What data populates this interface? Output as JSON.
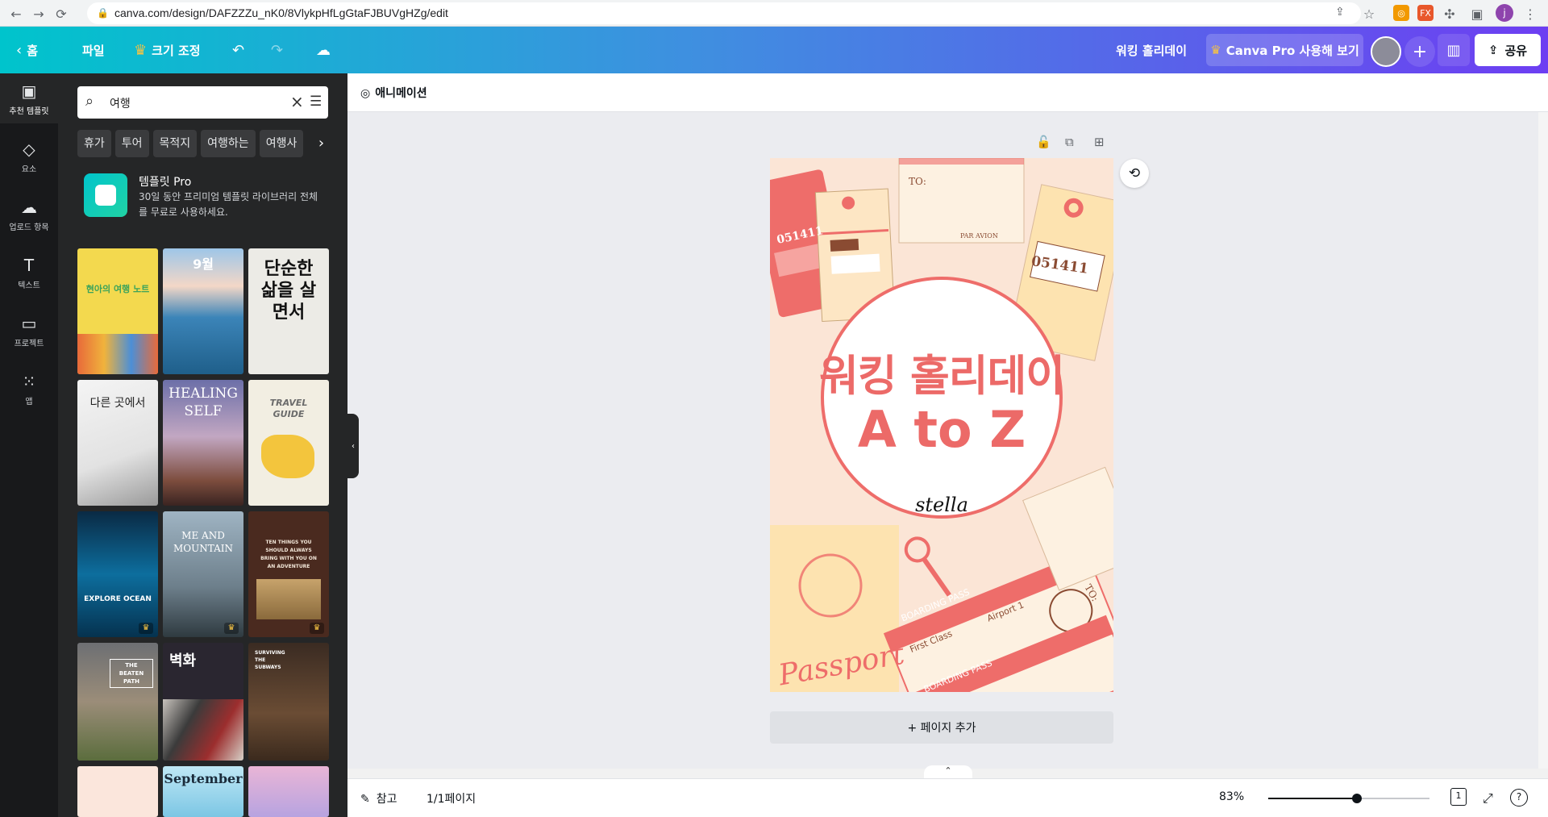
{
  "browser": {
    "url": "canva.com/design/DAFZZZu_nK0/8VlykpHfLgGtaFJBUVgHZg/edit",
    "profile_initial": "j"
  },
  "topbar": {
    "home": "홈",
    "file": "파일",
    "resize": "크기 조정",
    "doc_title": "워킹 홀리데이",
    "pro_button": "Canva Pro 사용해 보기",
    "share": "공유"
  },
  "rail": {
    "items": [
      {
        "label": "추천 템플릿",
        "icon": "template-icon"
      },
      {
        "label": "요소",
        "icon": "elements-icon"
      },
      {
        "label": "업로드 항목",
        "icon": "upload-icon"
      },
      {
        "label": "텍스트",
        "icon": "text-icon"
      },
      {
        "label": "프로젝트",
        "icon": "folder-icon"
      },
      {
        "label": "앱",
        "icon": "apps-icon"
      }
    ]
  },
  "panel": {
    "search_value": "여행",
    "chips": [
      "휴가",
      "투어",
      "목적지",
      "여행하는",
      "여행사"
    ],
    "promo_title": "템플릿 Pro",
    "promo_desc": "30일 동안 프리미엄 템플릿 라이브러리 전체를 무료로 사용하세요.",
    "thumbs": [
      {
        "text": "현아의 여행 노트"
      },
      {
        "text": "9월"
      },
      {
        "text": "단순한 삶을 살면서"
      },
      {
        "text": "다른 곳에서"
      },
      {
        "text": "HEALING SELF"
      },
      {
        "text": "TRAVEL GUIDE"
      },
      {
        "text": "EXPLORE OCEAN"
      },
      {
        "text": "ME AND MOUNTAIN"
      },
      {
        "text": "TEN THINGS YOU SHOULD ALWAYS BRING WITH YOU ON AN ADVENTURE"
      },
      {
        "text": "THE BEATEN PATH"
      },
      {
        "text": "벽화"
      },
      {
        "text": "SURVIVING THE SUBWAYS"
      },
      {
        "text": ""
      },
      {
        "text": "September"
      },
      {
        "text": ""
      }
    ]
  },
  "editor": {
    "animation": "애니메이션",
    "add_page": "+ 페이지 추가",
    "notes": "참고",
    "page_count": "1/1페이지",
    "zoom": "83%",
    "zoom_level": 0.55,
    "page_number": "1"
  },
  "design": {
    "title_line1": "워킹 홀리데이",
    "title_line2": "A to Z",
    "author": "stella",
    "tag_number_left": "051411",
    "tag_number_right": "051411",
    "to_label": "TO:",
    "par_avion": "PAR AVION",
    "boarding_pass": "BOARDING PASS",
    "first_class": "First Class",
    "airport": "Airport 1",
    "passport": "Passport",
    "to_label_2": "TO:"
  }
}
